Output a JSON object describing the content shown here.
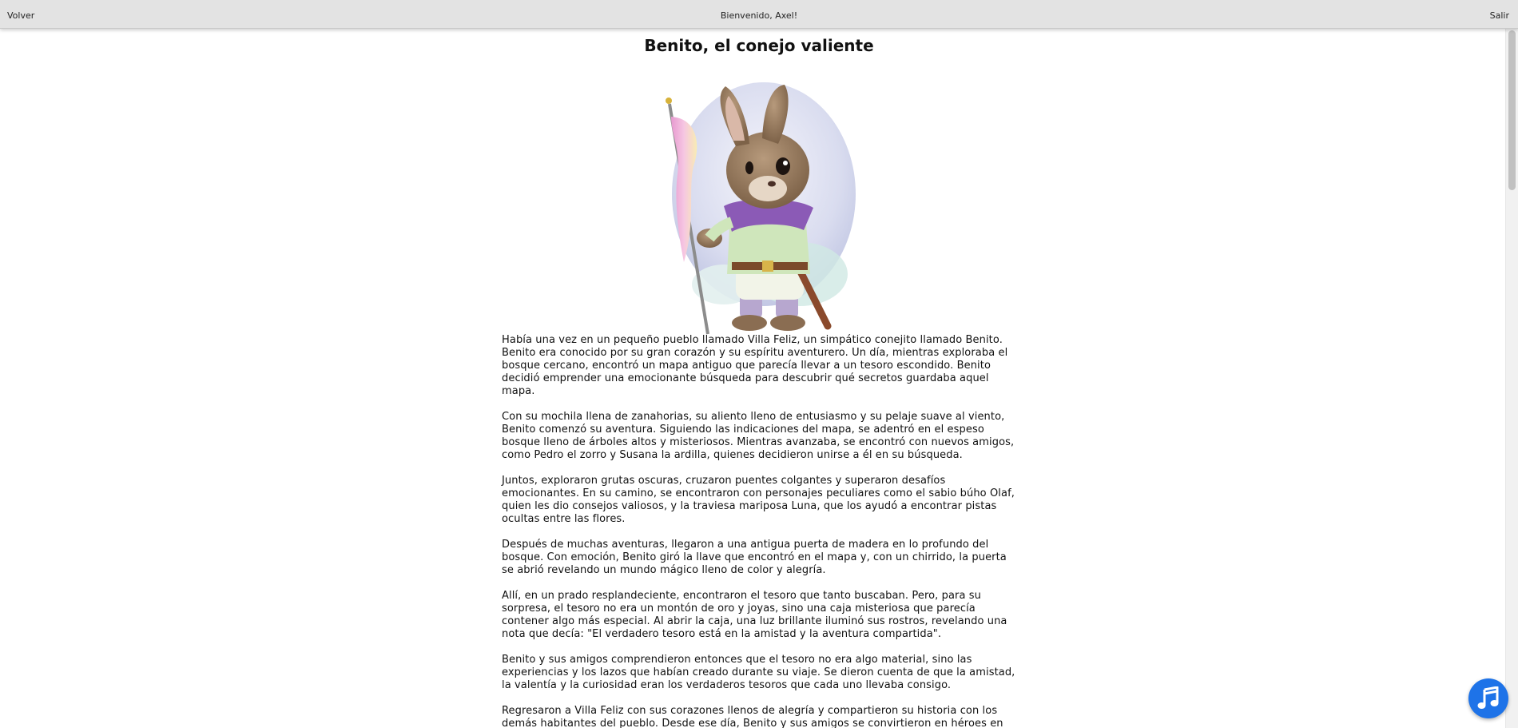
{
  "header": {
    "back_label": "Volver",
    "welcome_text": "Bienvenido, Axel!",
    "logout_label": "Salir"
  },
  "story": {
    "title": "Benito, el conejo valiente",
    "paragraphs": [
      "Había una vez en un pequeño pueblo llamado Villa Feliz, un simpático conejito llamado Benito. Benito era conocido por su gran corazón y su espíritu aventurero. Un día, mientras exploraba el bosque cercano, encontró un mapa antiguo que parecía llevar a un tesoro escondido. Benito decidió emprender una emocionante búsqueda para descubrir qué secretos guardaba aquel mapa.",
      "Con su mochila llena de zanahorias, su aliento lleno de entusiasmo y su pelaje suave al viento, Benito comenzó su aventura. Siguiendo las indicaciones del mapa, se adentró en el espeso bosque lleno de árboles altos y misteriosos. Mientras avanzaba, se encontró con nuevos amigos, como Pedro el zorro y Susana la ardilla, quienes decidieron unirse a él en su búsqueda.",
      "Juntos, exploraron grutas oscuras, cruzaron puentes colgantes y superaron desafíos emocionantes. En su camino, se encontraron con personajes peculiares como el sabio búho Olaf, quien les dio consejos valiosos, y la traviesa mariposa Luna, que los ayudó a encontrar pistas ocultas entre las flores.",
      "Después de muchas aventuras, llegaron a una antigua puerta de madera en lo profundo del bosque. Con emoción, Benito giró la llave que encontró en el mapa y, con un chirrido, la puerta se abrió revelando un mundo mágico lleno de color y alegría.",
      "Allí, en un prado resplandeciente, encontraron el tesoro que tanto buscaban. Pero, para su sorpresa, el tesoro no era un montón de oro y joyas, sino una caja misteriosa que parecía contener algo más especial. Al abrir la caja, una luz brillante iluminó sus rostros, revelando una nota que decía: \"El verdadero tesoro está en la amistad y la aventura compartida\".",
      "Benito y sus amigos comprendieron entonces que el tesoro no era algo material, sino las experiencias y los lazos que habían creado durante su viaje. Se dieron cuenta de que la amistad, la valentía y la curiosidad eran los verdaderos tesoros que cada uno llevaba consigo.",
      "Regresaron a Villa Feliz con sus corazones llenos de alegría y compartieron su historia con los demás habitantes del pueblo. Desde ese día, Benito y sus amigos se convirtieron en héroes en Villa Feliz, inspirando a otros a explorar, descubrir y valorar la importancia de la amistad."
    ]
  },
  "music_button": {
    "icon": "music-note-icon",
    "color": "#1e73e8"
  },
  "illustration": {
    "subject": "rabbit-with-flag"
  }
}
